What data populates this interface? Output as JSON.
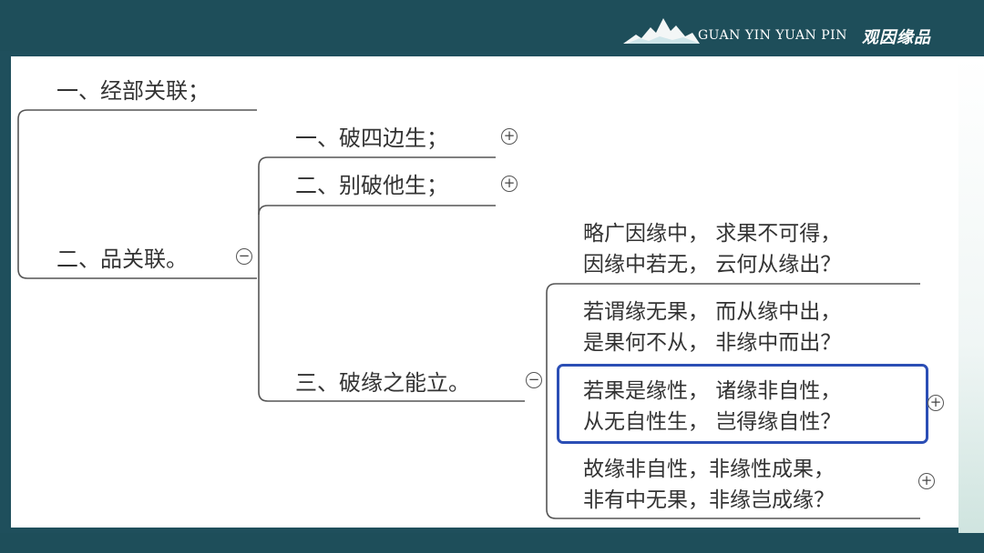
{
  "header": {
    "brand_text": "GUAN YIN YUAN PIN",
    "brand_script": "观因缘品"
  },
  "mindmap": {
    "node1": "一、经部关联；",
    "node2": "二、品关联。",
    "sub1": "一、破四边生；",
    "sub2": "二、别破他生；",
    "sub3": "三、破缘之能立。",
    "leaves": [
      {
        "line1": "略广因缘中， 求果不可得，",
        "line2": "因缘中若无， 云何从缘出？"
      },
      {
        "line1": "若谓缘无果， 而从缘中出，",
        "line2": "是果何不从， 非缘中而出？"
      },
      {
        "line1": "若果是缘性， 诸缘非自性，",
        "line2": "从无自性生， 岂得缘自性？"
      },
      {
        "line1": "故缘非自性，非缘性成果，",
        "line2": "非有中无果，非缘岂成缘？"
      }
    ],
    "expand_symbol": "+",
    "collapse_symbol": "−"
  }
}
